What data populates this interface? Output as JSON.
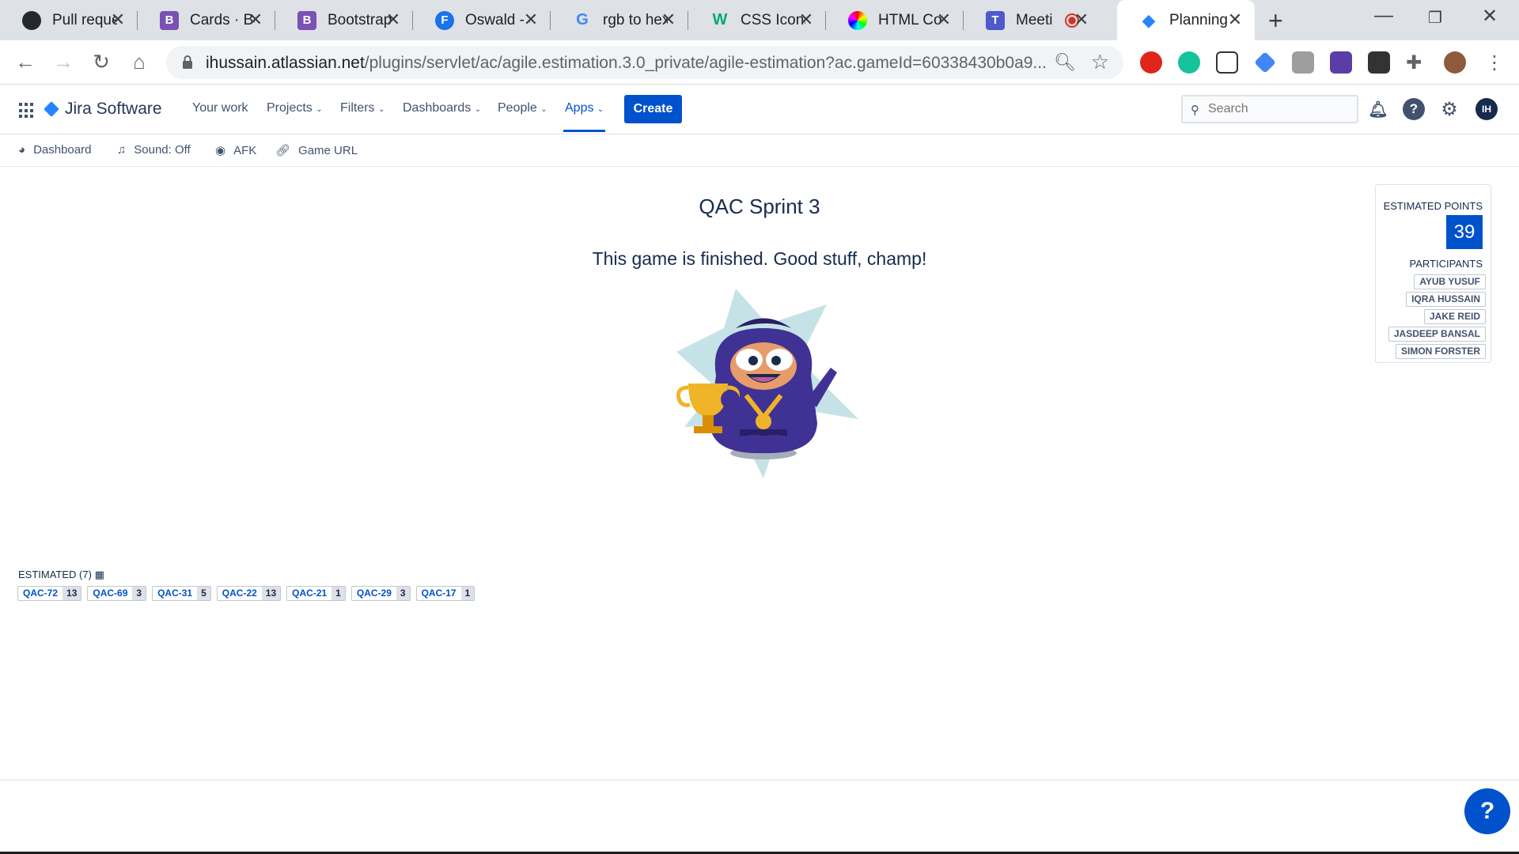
{
  "browser": {
    "tabs": [
      {
        "title": "Pull reque",
        "icon": "github-icon",
        "color": "#24292e",
        "glyph": "●"
      },
      {
        "title": "Cards · Bo",
        "icon": "bootstrap-icon",
        "color": "#7952b3",
        "glyph": "B"
      },
      {
        "title": "Bootstrap",
        "icon": "bootstrap-icon",
        "color": "#7952b3",
        "glyph": "B"
      },
      {
        "title": "Oswald - (",
        "icon": "google-fonts-icon",
        "color": "#1a73e8",
        "glyph": "F"
      },
      {
        "title": "rgb to hex",
        "icon": "google-icon",
        "color": "#ffffff",
        "glyph": "G"
      },
      {
        "title": "CSS Icons",
        "icon": "w3schools-icon",
        "color": "#ffffff",
        "glyph": "W"
      },
      {
        "title": "HTML Col",
        "icon": "color-wheel-icon",
        "color": "#ffffff",
        "glyph": "◉"
      },
      {
        "title": "Meeti",
        "icon": "teams-icon",
        "color": "#5059c9",
        "glyph": "T"
      },
      {
        "title": "Planning",
        "icon": "jira-icon",
        "color": "#2684ff",
        "glyph": "◆"
      }
    ],
    "url_host": "ihussain.atlassian.net",
    "url_path": "/plugins/servlet/ac/agile.estimation.3.0_private/agile-estimation?ac.gameId=60338430b0a9..."
  },
  "jira": {
    "product": "Jira Software",
    "menu": [
      "Your work",
      "Projects",
      "Filters",
      "Dashboards",
      "People",
      "Apps"
    ],
    "create_label": "Create",
    "search_placeholder": "Search",
    "avatar_initials": "IH"
  },
  "subnav": {
    "dashboard": "Dashboard",
    "sound": "Sound: Off",
    "afk": "AFK",
    "game_url": "Game URL"
  },
  "game": {
    "title": "QAC Sprint 3",
    "message": "This game is finished. Good stuff, champ!",
    "estimated_points_label": "ESTIMATED POINTS",
    "estimated_points": "39",
    "participants_label": "PARTICIPANTS",
    "participants": [
      "AYUB YUSUF",
      "IQRA HUSSAIN",
      "JAKE REID",
      "JASDEEP BANSAL",
      "SIMON FORSTER"
    ],
    "estimated_label": "ESTIMATED (7)",
    "issues": [
      {
        "key": "QAC-72",
        "points": "13"
      },
      {
        "key": "QAC-69",
        "points": "3"
      },
      {
        "key": "QAC-31",
        "points": "5"
      },
      {
        "key": "QAC-22",
        "points": "13"
      },
      {
        "key": "QAC-21",
        "points": "1"
      },
      {
        "key": "QAC-29",
        "points": "3"
      },
      {
        "key": "QAC-17",
        "points": "1"
      }
    ]
  },
  "help_label": "?"
}
